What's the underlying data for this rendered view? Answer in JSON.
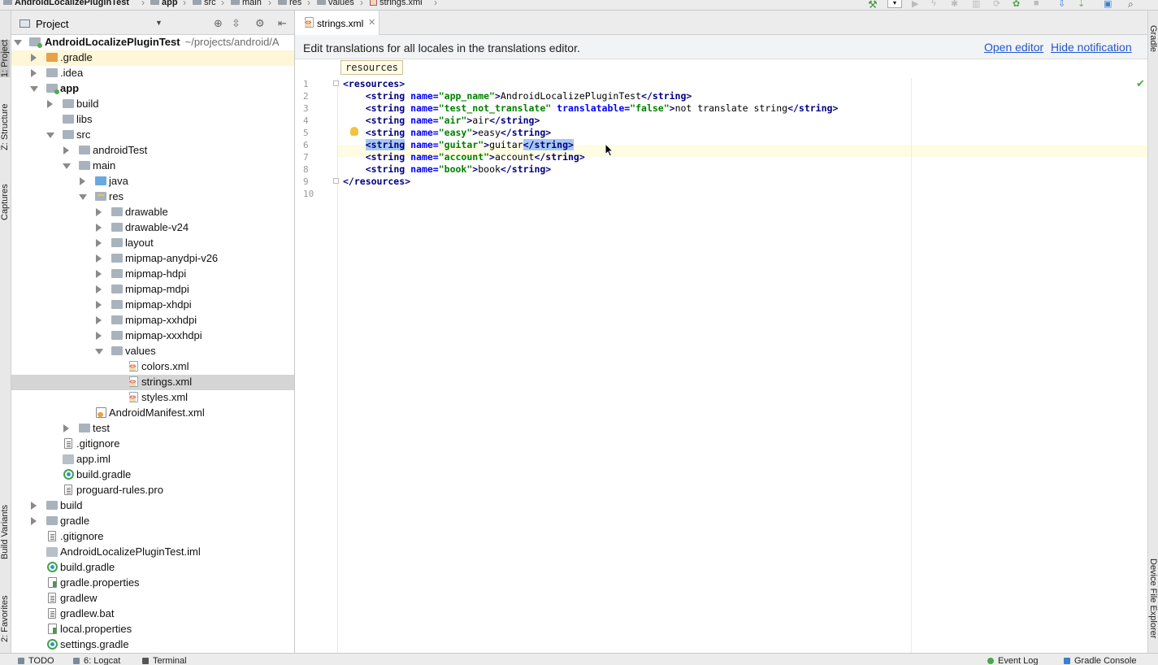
{
  "navbar": {
    "crumbs": [
      "AndroidLocalizePluginTest",
      "app",
      "src",
      "main",
      "res",
      "values",
      "strings.xml"
    ]
  },
  "left_strip": {
    "tabs": [
      "1: Project",
      "Z: Structure",
      "Captures",
      "Build Variants",
      "2: Favorites"
    ]
  },
  "right_strip": {
    "tabs": [
      "Gradle",
      "Device File Explorer"
    ]
  },
  "project_panel": {
    "title": "Project",
    "root_name": "AndroidLocalizePluginTest",
    "root_path": "~/projects/android/A",
    "items": [
      {
        "label": ".gradle"
      },
      {
        "label": ".idea"
      },
      {
        "label": "app"
      },
      {
        "label": "build"
      },
      {
        "label": "libs"
      },
      {
        "label": "src"
      },
      {
        "label": "androidTest"
      },
      {
        "label": "main"
      },
      {
        "label": "java"
      },
      {
        "label": "res"
      },
      {
        "label": "drawable"
      },
      {
        "label": "drawable-v24"
      },
      {
        "label": "layout"
      },
      {
        "label": "mipmap-anydpi-v26"
      },
      {
        "label": "mipmap-hdpi"
      },
      {
        "label": "mipmap-mdpi"
      },
      {
        "label": "mipmap-xhdpi"
      },
      {
        "label": "mipmap-xxhdpi"
      },
      {
        "label": "mipmap-xxxhdpi"
      },
      {
        "label": "values"
      },
      {
        "label": "colors.xml"
      },
      {
        "label": "strings.xml"
      },
      {
        "label": "styles.xml"
      },
      {
        "label": "AndroidManifest.xml"
      },
      {
        "label": "test"
      },
      {
        "label": ".gitignore"
      },
      {
        "label": "app.iml"
      },
      {
        "label": "build.gradle"
      },
      {
        "label": "proguard-rules.pro"
      },
      {
        "label": "build"
      },
      {
        "label": "gradle"
      },
      {
        "label": ".gitignore"
      },
      {
        "label": "AndroidLocalizePluginTest.iml"
      },
      {
        "label": "build.gradle"
      },
      {
        "label": "gradle.properties"
      },
      {
        "label": "gradlew"
      },
      {
        "label": "gradlew.bat"
      },
      {
        "label": "local.properties"
      },
      {
        "label": "settings.gradle"
      }
    ]
  },
  "editor": {
    "tab_label": "strings.xml",
    "notification": {
      "message": "Edit translations for all locales in the translations editor.",
      "open_editor": "Open editor",
      "hide_notification": "Hide notification"
    },
    "breadcrumb_tag": "resources",
    "line_numbers": [
      "1",
      "2",
      "3",
      "4",
      "5",
      "6",
      "7",
      "8",
      "9",
      "10"
    ],
    "code": {
      "resources_open": "<resources>",
      "resources_close": "</resources>",
      "string_open": "<string",
      "string_close": "</string>",
      "name_attr": "name=",
      "translatable_attr": "translatable=",
      "close_bracket": ">",
      "strings": [
        {
          "name": "\"app_name\"",
          "text": "AndroidLocalizePluginTest"
        },
        {
          "name": "\"test_not_translate\"",
          "translatable": "\"false\"",
          "text": "not translate string"
        },
        {
          "name": "\"air\"",
          "text": "air"
        },
        {
          "name": "\"easy\"",
          "text": "easy"
        },
        {
          "name": "\"guitar\"",
          "text": "guitar"
        },
        {
          "name": "\"account\"",
          "text": "account"
        },
        {
          "name": "\"book\"",
          "text": "book"
        }
      ]
    }
  },
  "bottom_bar": {
    "todo": "TODO",
    "logcat": "6: Logcat",
    "terminal": "Terminal",
    "event_log": "Event Log",
    "gradle_console": "Gradle Console"
  }
}
